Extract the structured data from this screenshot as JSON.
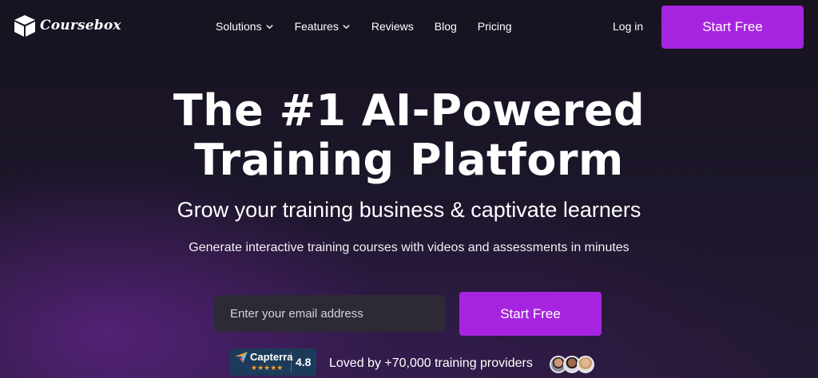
{
  "header": {
    "brand": "Coursebox",
    "logo_icon": "box-icon",
    "nav": [
      {
        "label": "Solutions",
        "has_dropdown": true
      },
      {
        "label": "Features",
        "has_dropdown": true
      },
      {
        "label": "Reviews",
        "has_dropdown": false
      },
      {
        "label": "Blog",
        "has_dropdown": false
      },
      {
        "label": "Pricing",
        "has_dropdown": false
      }
    ],
    "login_label": "Log in",
    "cta_label": "Start Free"
  },
  "hero": {
    "title_line1": "The #1 AI-Powered",
    "title_line2": "Training Platform",
    "subtitle": "Grow your training business & captivate learners",
    "description": "Generate interactive training courses with videos and assessments in minutes",
    "email_placeholder": "Enter your email address",
    "cta_label": "Start Free"
  },
  "social_proof": {
    "capterra_brand": "Capterra",
    "capterra_stars": "★★★★★",
    "capterra_score": "4.8",
    "loved_text": "Loved by +70,000 training providers",
    "avatar_count": 3
  },
  "colors": {
    "accent": "#a624e0",
    "background": "#1b1528",
    "input_bg": "#2d2a35",
    "capterra_bg": "#1c3b5a",
    "star": "#ff9d28"
  }
}
